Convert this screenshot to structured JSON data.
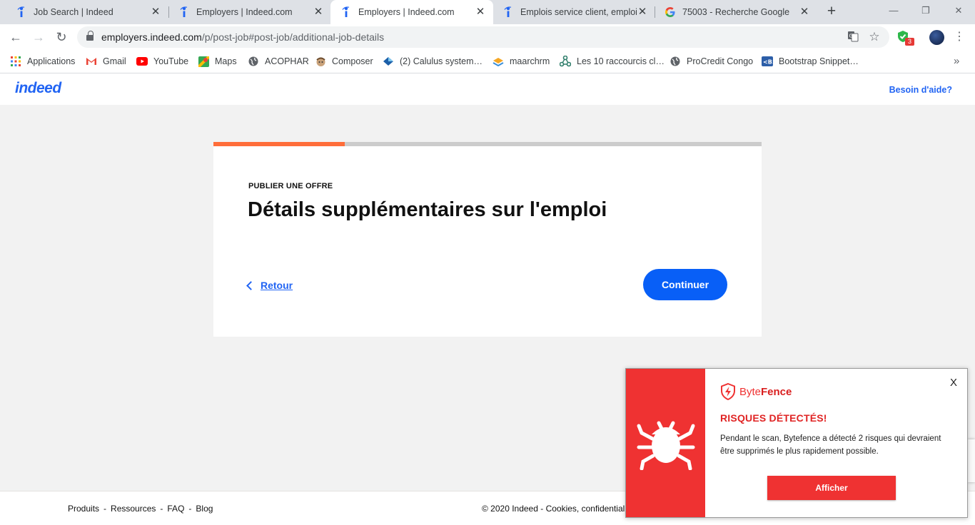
{
  "browser": {
    "tabs": [
      {
        "title": "Job Search | Indeed",
        "favicon": "indeed-icon",
        "active": false
      },
      {
        "title": "Employers | Indeed.com",
        "favicon": "indeed-icon",
        "active": false
      },
      {
        "title": "Employers | Indeed.com",
        "favicon": "indeed-icon",
        "active": true
      },
      {
        "title": "Emplois service client, emploi |",
        "favicon": "indeed-icon",
        "active": false
      },
      {
        "title": "75003 - Recherche Google",
        "favicon": "google-icon",
        "active": false
      }
    ],
    "url_host": "employers.indeed.com",
    "url_path": "/p/post-job#post-job/additional-job-details",
    "extension_badge": "3",
    "bookmarks": [
      {
        "label": "Applications",
        "icon": "apps-grid-icon"
      },
      {
        "label": "Gmail",
        "icon": "gmail-icon"
      },
      {
        "label": "YouTube",
        "icon": "youtube-icon"
      },
      {
        "label": "Maps",
        "icon": "maps-icon"
      },
      {
        "label": "ACOPHAR",
        "icon": "globe-icon"
      },
      {
        "label": "Composer",
        "icon": "composer-icon"
      },
      {
        "label": "(2) Calulus system…",
        "icon": "calculus-icon"
      },
      {
        "label": "maarchrm",
        "icon": "maarch-icon"
      },
      {
        "label": "Les 10 raccourcis cl…",
        "icon": "network-icon"
      },
      {
        "label": "ProCredit Congo",
        "icon": "globe-icon"
      },
      {
        "label": "Bootstrap Snippet…",
        "icon": "bootstrap-icon"
      }
    ]
  },
  "header": {
    "logo": "indeed",
    "help_link": "Besoin d'aide?"
  },
  "form": {
    "progress_fraction": 0.24,
    "eyebrow": "PUBLIER UNE OFFRE",
    "title": "Détails supplémentaires sur l'emploi",
    "back_label": "Retour",
    "continue_label": "Continuer"
  },
  "footer": {
    "links": [
      "Produits",
      "Ressources",
      "FAQ",
      "Blog"
    ],
    "separator": "-",
    "copyright": "© 2020 Indeed - Cookies, confidentiali"
  },
  "popup": {
    "brand_regular": "Byte",
    "brand_bold": "Fence",
    "close_label": "X",
    "title": "RISQUES DÉTECTÉS!",
    "message": "Pendant le scan, Bytefence a détecté 2 risques qui devraient être supprimés le plus rapidement possible.",
    "button_label": "Afficher"
  },
  "colors": {
    "indeed_blue": "#2164f3",
    "cta_blue": "#085ff7",
    "progress_orange": "#ff6d3a",
    "bytefence_red": "#ef3232"
  }
}
